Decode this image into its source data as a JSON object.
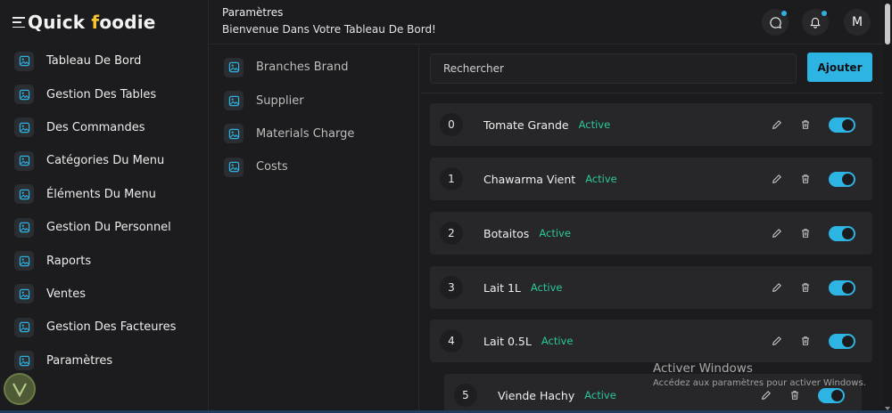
{
  "brand": {
    "logo_part1": "Quick ",
    "logo_accent": "f",
    "logo_part2": "oodie",
    "accent_color": "#f5c531"
  },
  "header": {
    "title": "Paramètres",
    "subtitle": "Bienvenue Dans Votre Tableau De Bord!",
    "avatar_letter": "M",
    "icons": [
      "chat-icon",
      "bell-icon"
    ]
  },
  "sidebar": {
    "items": [
      {
        "label": "Tableau De Bord",
        "icon": "image-icon"
      },
      {
        "label": "Gestion Des Tables",
        "icon": "image-icon"
      },
      {
        "label": "Des Commandes",
        "icon": "image-icon"
      },
      {
        "label": "Catégories Du Menu",
        "icon": "image-icon"
      },
      {
        "label": "Éléments Du Menu",
        "icon": "image-icon"
      },
      {
        "label": "Gestion Du Personnel",
        "icon": "image-icon"
      },
      {
        "label": "Raports",
        "icon": "image-icon"
      },
      {
        "label": "Ventes",
        "icon": "image-icon"
      },
      {
        "label": "Gestion Des Facteures",
        "icon": "image-icon"
      },
      {
        "label": "Paramètres",
        "icon": "image-icon"
      }
    ]
  },
  "settings_menu": {
    "items": [
      {
        "label": "Branches Brand"
      },
      {
        "label": "Supplier"
      },
      {
        "label": "Materials Charge"
      },
      {
        "label": "Costs"
      }
    ]
  },
  "main": {
    "search_placeholder": "Rechercher",
    "add_label": "Ajouter",
    "items": [
      {
        "index": "0",
        "name": "Tomate Grande",
        "status": "Active",
        "enabled": true
      },
      {
        "index": "1",
        "name": "Chawarma Vient",
        "status": "Active",
        "enabled": true
      },
      {
        "index": "2",
        "name": "Botaitos",
        "status": "Active",
        "enabled": true
      },
      {
        "index": "3",
        "name": "Lait 1L",
        "status": "Active",
        "enabled": true
      },
      {
        "index": "4",
        "name": "Lait 0.5L",
        "status": "Active",
        "enabled": true
      },
      {
        "index": "5",
        "name": "Viende Hachy",
        "status": "Active",
        "enabled": true
      }
    ]
  },
  "watermark": {
    "line1": "Activer Windows",
    "line2": "Accédez aux paramètres pour activer Windows."
  },
  "colors": {
    "accent": "#2eb4e2",
    "status_active": "#2bc79a",
    "background": "#1c1c1e",
    "row": "#27272a"
  }
}
